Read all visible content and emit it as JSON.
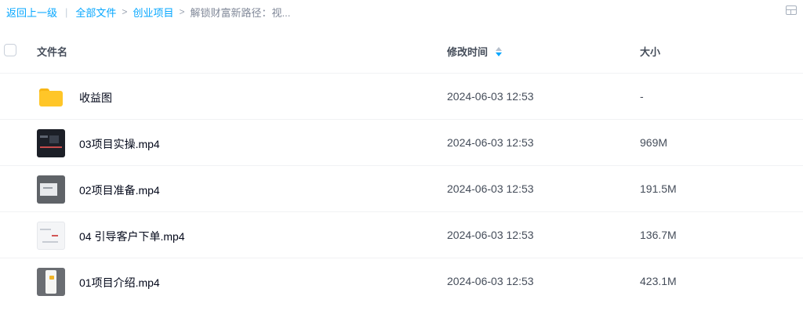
{
  "breadcrumb": {
    "back": "返回上一级",
    "sep_bar": "|",
    "sep_gt": ">",
    "items": [
      "全部文件",
      "创业项目"
    ],
    "current": "解锁财富新路径：视..."
  },
  "header": {
    "name": "文件名",
    "time": "修改时间",
    "size": "大小"
  },
  "files": [
    {
      "name": "收益图",
      "time": "2024-06-03 12:53",
      "size": "-",
      "type": "folder"
    },
    {
      "name": "03项目实操.mp4",
      "time": "2024-06-03 12:53",
      "size": "969M",
      "type": "video"
    },
    {
      "name": "02项目准备.mp4",
      "time": "2024-06-03 12:53",
      "size": "191.5M",
      "type": "video"
    },
    {
      "name": "04 引导客户下单.mp4",
      "time": "2024-06-03 12:53",
      "size": "136.7M",
      "type": "video"
    },
    {
      "name": "01项目介绍.mp4",
      "time": "2024-06-03 12:53",
      "size": "423.1M",
      "type": "video"
    }
  ],
  "colors": {
    "accent": "#06a7ff",
    "folder": "#ffc628"
  },
  "icons": {
    "view_toggle": "grid-view-icon",
    "sort": "sort-icon",
    "folder": "folder-icon",
    "video": "video-thumbnail"
  }
}
